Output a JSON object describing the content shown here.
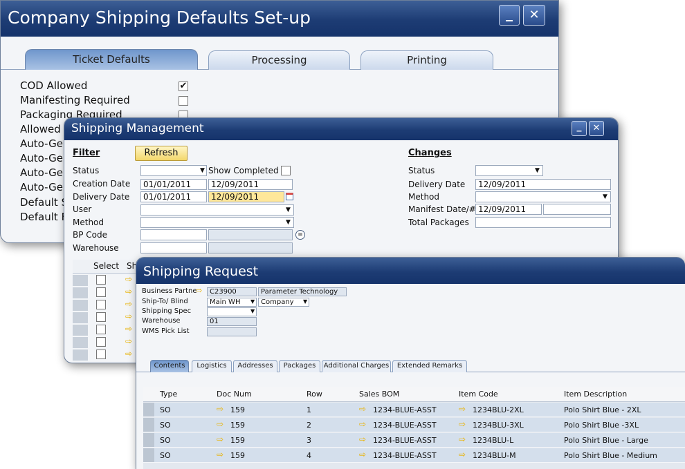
{
  "window1": {
    "title": "Company Shipping Defaults Set-up",
    "tabs": [
      "Ticket Defaults",
      "Processing",
      "Printing"
    ],
    "rows": [
      {
        "label": "COD Allowed",
        "checked": true
      },
      {
        "label": "Manifesting Required",
        "checked": false
      },
      {
        "label": "Packaging Required",
        "checked": false
      },
      {
        "label": "Allowed"
      },
      {
        "label": "Auto-Ge"
      },
      {
        "label": "Auto-Ge"
      },
      {
        "label": "Auto-Ge"
      },
      {
        "label": "Auto-Ge"
      },
      {
        "label": "Default S"
      },
      {
        "label": "Default F"
      }
    ],
    "minimize": "_",
    "close": "✕"
  },
  "window2": {
    "title": "Shipping Management",
    "filter_heading": "Filter",
    "refresh": "Refresh",
    "status_label": "Status",
    "show_completed": "Show Completed",
    "creation_date_label": "Creation Date",
    "creation_from": "01/01/2011",
    "creation_to": "12/09/2011",
    "delivery_date_label": "Delivery Date",
    "delivery_from": "01/01/2011",
    "delivery_to": "12/09/2011",
    "user_label": "User",
    "method_label": "Method",
    "bp_code_label": "BP Code",
    "warehouse_label": "Warehouse",
    "changes_heading": "Changes",
    "ch_status_label": "Status",
    "ch_delivery_label": "Delivery Date",
    "ch_delivery_value": "12/09/2011",
    "ch_method_label": "Method",
    "ch_manifest_label": "Manifest Date/#",
    "ch_manifest_value": "12/09/2011",
    "ch_total_label": "Total Packages",
    "grid_select": "Select",
    "grid_sh": "Sh",
    "minimize": "_",
    "close": "✕"
  },
  "window3": {
    "title": "Shipping Request",
    "bp_label": "Business Partne",
    "bp_code": "C23900",
    "bp_name": "Parameter Technology",
    "shipto_label": "Ship-To/ Blind",
    "shipto_value": "Main WH",
    "blind_value": "Company",
    "spec_label": "Shipping Spec",
    "warehouse_label": "Warehouse",
    "warehouse_value": "01",
    "wms_label": "WMS Pick List",
    "tabs": [
      "Contents",
      "Logistics",
      "Addresses",
      "Packages",
      "Additional Charges",
      "Extended Remarks"
    ],
    "columns": [
      "Type",
      "Doc Num",
      "Row",
      "Sales BOM",
      "Item Code",
      "Item Description"
    ],
    "rows": [
      {
        "type": "SO",
        "doc": "159",
        "row": "1",
        "bom": "1234-BLUE-ASST",
        "item": "1234BLU-2XL",
        "desc": "Polo Shirt Blue - 2XL"
      },
      {
        "type": "SO",
        "doc": "159",
        "row": "2",
        "bom": "1234-BLUE-ASST",
        "item": "1234BLU-3XL",
        "desc": "Polo Shirt Blue -3XL"
      },
      {
        "type": "SO",
        "doc": "159",
        "row": "3",
        "bom": "1234-BLUE-ASST",
        "item": "1234BLU-L",
        "desc": "Polo Shirt Blue - Large"
      },
      {
        "type": "SO",
        "doc": "159",
        "row": "4",
        "bom": "1234-BLUE-ASST",
        "item": "1234BLU-M",
        "desc": "Polo Shirt Blue - Medium"
      }
    ]
  }
}
